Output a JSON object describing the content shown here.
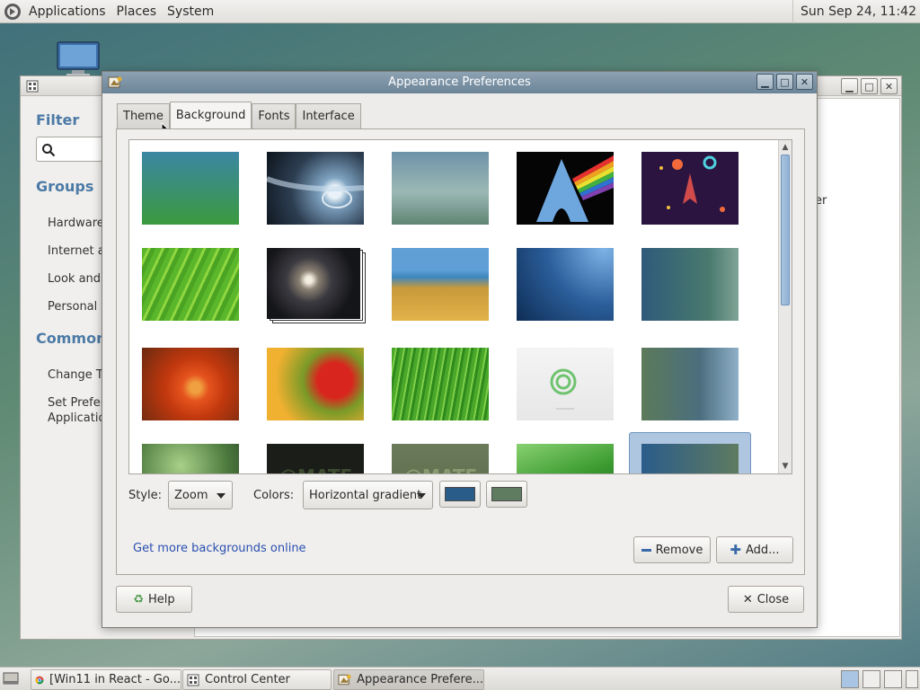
{
  "top_panel": {
    "menus": [
      "Applications",
      "Places",
      "System"
    ],
    "clock": "Sun Sep 24, 11:42"
  },
  "control_center": {
    "filter_label": "Filter",
    "groups_label": "Groups",
    "group_items": [
      "Hardware",
      "Internet ar",
      "Look and F",
      "Personal"
    ],
    "common_label": "Common T",
    "common_items": [
      "Change Th",
      "Set Prefere",
      "Applicatio"
    ],
    "right_fragment": "er"
  },
  "dialog": {
    "title": "Appearance Preferences",
    "tabs": [
      "Theme",
      "Background",
      "Fonts",
      "Interface"
    ],
    "active_tab": "Background",
    "style_label": "Style:",
    "style_value": "Zoom",
    "colors_label": "Colors:",
    "colors_value": "Horizontal gradient",
    "primary_color": "#2a5c8a",
    "secondary_color": "#5f7b60",
    "link_text": "Get more backgrounds online",
    "remove_label": "Remove",
    "add_label": "Add...",
    "help_label": "Help",
    "close_label": "Close"
  },
  "thumb_text": {
    "mate_a": "@MATE",
    "mate_b": "@MATE"
  },
  "taskbar": {
    "tasks": [
      "[Win11 in React - Go...",
      "Control Center",
      "Appearance Prefere..."
    ]
  },
  "colors": {
    "link": "#2a4fb0",
    "group_heading": "#4c7aa6",
    "selection": "#aec6e0"
  }
}
